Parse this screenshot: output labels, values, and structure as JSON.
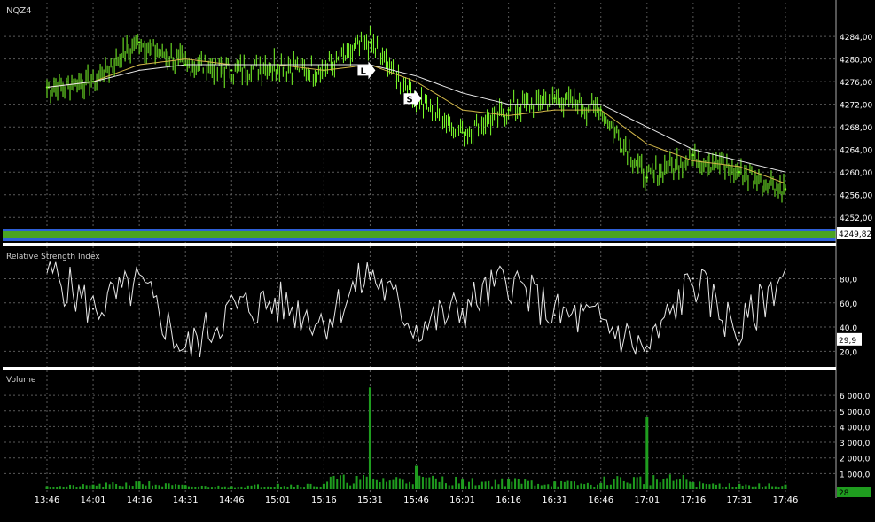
{
  "symbol": "NQZ4",
  "colors": {
    "background": "#000000",
    "grid": "#5a5a5a",
    "price": "#7cff2a",
    "ma_fast": "#d4b84a",
    "ma_slow": "#e8e8e8",
    "rsi": "#e8e8e8",
    "volume": "#1f9d1f",
    "band_blue": "#2e5fd6",
    "band_green": "#4aa321",
    "separator": "#ffffff"
  },
  "time_labels": [
    "13:46",
    "14:01",
    "14:16",
    "14:31",
    "14:46",
    "15:01",
    "15:16",
    "15:31",
    "15:46",
    "16:01",
    "16:16",
    "16:31",
    "16:46",
    "17:01",
    "17:16",
    "17:31",
    "17:46"
  ],
  "chart_data": [
    {
      "type": "line",
      "title": "NQZ4",
      "x": [
        "13:46",
        "14:01",
        "14:16",
        "14:31",
        "14:46",
        "15:01",
        "15:16",
        "15:31",
        "15:46",
        "16:01",
        "16:16",
        "16:31",
        "16:46",
        "17:01",
        "17:16",
        "17:31",
        "17:46"
      ],
      "series": [
        {
          "values": [
            4275,
            4276,
            4283,
            4279,
            4278,
            4279,
            4278,
            4283,
            4273,
            4267,
            4271,
            4273,
            4271,
            4259,
            4263,
            4260,
            4257
          ]
        },
        {
          "values": [
            4275,
            4276,
            4279,
            4280,
            4279,
            4279,
            4278,
            4279,
            4276,
            4271,
            4270,
            4271,
            4271,
            4265,
            4262,
            4261,
            4258
          ]
        },
        {
          "values": [
            4275,
            4276,
            4278,
            4279,
            4279,
            4279,
            4279,
            4279,
            4277,
            4274,
            4272,
            4272,
            4272,
            4268,
            4264,
            4262,
            4260
          ]
        }
      ],
      "markers": [
        {
          "label": "L",
          "x": "15:31",
          "value": 4278
        },
        {
          "label": "S",
          "x": "15:46",
          "value": 4273
        }
      ],
      "last_value_label": "4249,82",
      "last_value": 4249.82,
      "ylim": [
        4250,
        4287
      ],
      "y_ticks": [
        "4284,00",
        "4280,00",
        "4276,00",
        "4272,00",
        "4268,00",
        "4264,00",
        "4260,00",
        "4256,00",
        "4252,00"
      ],
      "y_tick_values": [
        4284,
        4280,
        4276,
        4272,
        4268,
        4264,
        4260,
        4256,
        4252
      ],
      "grid": true
    },
    {
      "type": "line",
      "title": "Relative Strength Index",
      "x": [
        "13:46",
        "14:01",
        "14:16",
        "14:31",
        "14:46",
        "15:01",
        "15:16",
        "15:31",
        "15:46",
        "16:01",
        "16:16",
        "16:31",
        "16:46",
        "17:01",
        "17:16",
        "17:31",
        "17:46"
      ],
      "series": [
        {
          "values": [
            88,
            55,
            75,
            20,
            55,
            60,
            45,
            85,
            40,
            55,
            80,
            50,
            45,
            20,
            80,
            35,
            88
          ]
        }
      ],
      "last_value_label": "29,9",
      "last_value": 29.9,
      "ylim": [
        10,
        95
      ],
      "y_ticks": [
        "80,0",
        "60,0",
        "40,0",
        "20,0"
      ],
      "y_tick_values": [
        80,
        60,
        40,
        20
      ],
      "grid": true
    },
    {
      "type": "bar",
      "title": "Volume",
      "x": [
        "13:46",
        "14:01",
        "14:16",
        "14:31",
        "14:46",
        "15:01",
        "15:16",
        "15:31",
        "15:46",
        "16:01",
        "16:16",
        "16:31",
        "16:46",
        "17:01",
        "17:16",
        "17:31",
        "17:46"
      ],
      "values": [
        200,
        300,
        500,
        250,
        200,
        350,
        350,
        6500,
        1500,
        600,
        650,
        500,
        400,
        4600,
        450,
        350,
        300
      ],
      "last_value_label": "28",
      "last_value": 28,
      "ylim": [
        0,
        6800
      ],
      "y_ticks": [
        "6 000,0",
        "5 000,0",
        "4 000,0",
        "3 000,0",
        "2 000,0",
        "1 000,0"
      ],
      "y_tick_values": [
        6000,
        5000,
        4000,
        3000,
        2000,
        1000
      ],
      "grid": true
    }
  ]
}
